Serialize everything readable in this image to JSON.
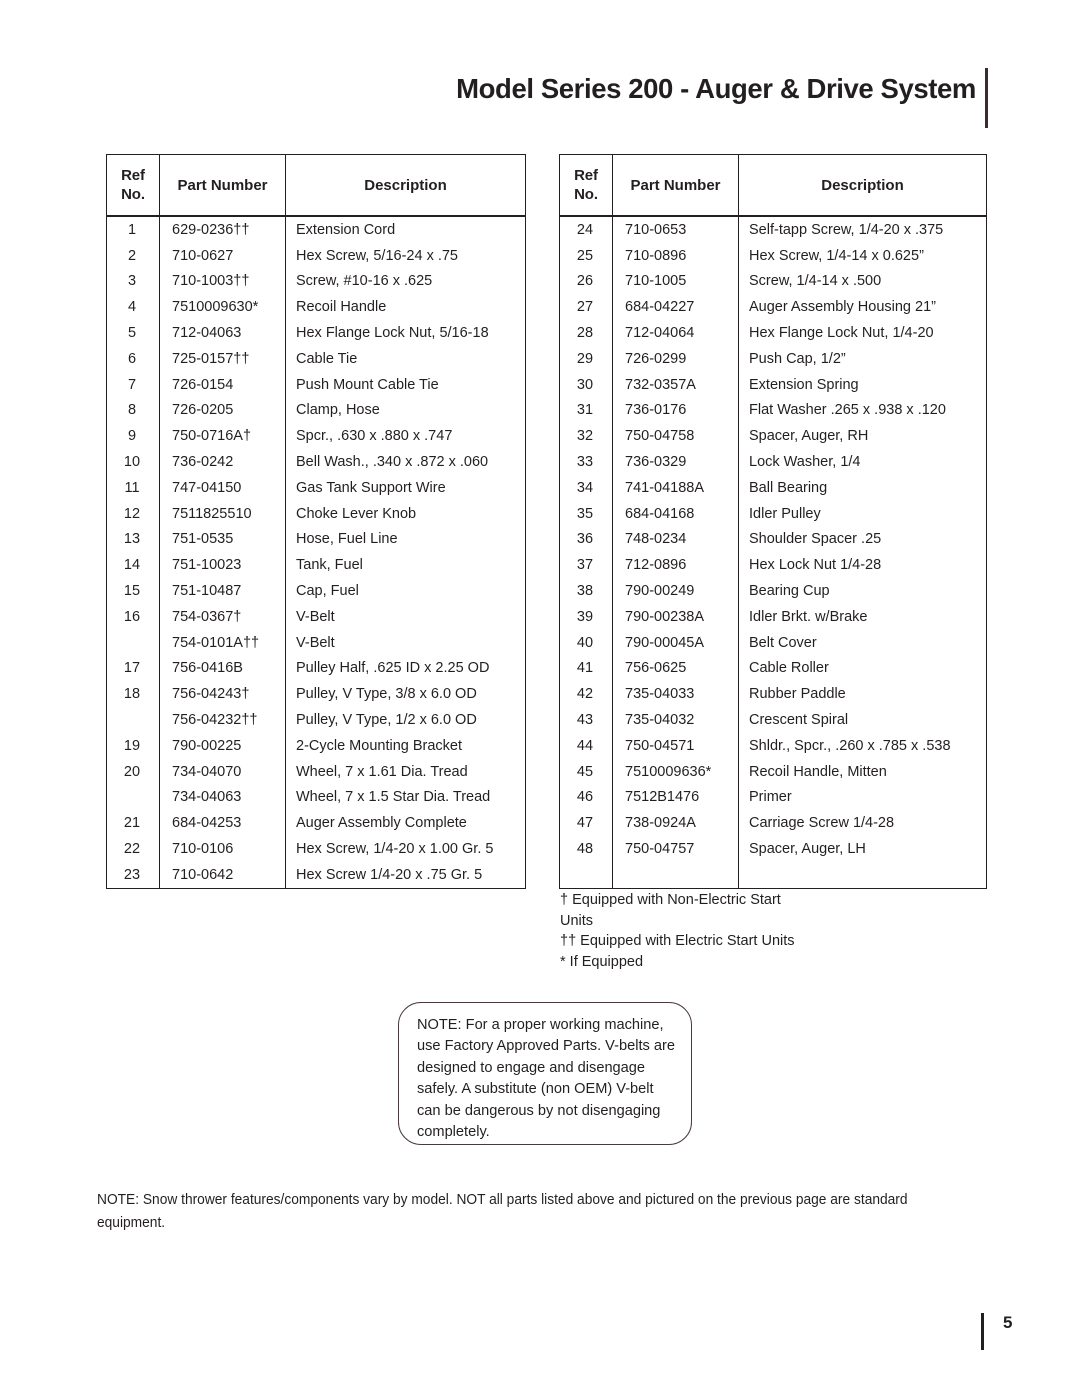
{
  "header": {
    "title": "Model Series 200  - Auger & Drive System"
  },
  "table_columns": {
    "ref_line1": "Ref",
    "ref_line2": "No.",
    "part_number": "Part Number",
    "description": "Description"
  },
  "parts_left": [
    {
      "ref": "1",
      "part": "629-0236††",
      "desc": "Extension Cord"
    },
    {
      "ref": "2",
      "part": "710-0627",
      "desc": "Hex Screw, 5/16-24 x .75"
    },
    {
      "ref": "3",
      "part": "710-1003††",
      "desc": "Screw, #10-16 x .625"
    },
    {
      "ref": "4",
      "part": "7510009630*",
      "desc": "Recoil Handle"
    },
    {
      "ref": "5",
      "part": "712-04063",
      "desc": "Hex Flange Lock Nut, 5/16-18"
    },
    {
      "ref": "6",
      "part": "725-0157††",
      "desc": "Cable Tie"
    },
    {
      "ref": "7",
      "part": "726-0154",
      "desc": "Push Mount Cable Tie"
    },
    {
      "ref": "8",
      "part": "726-0205",
      "desc": "Clamp, Hose"
    },
    {
      "ref": "9",
      "part": "750-0716A†",
      "desc": "Spcr., .630 x .880 x .747"
    },
    {
      "ref": "10",
      "part": "736-0242",
      "desc": "Bell Wash., .340  x .872 x .060"
    },
    {
      "ref": "11",
      "part": "747-04150",
      "desc": "Gas Tank Support Wire"
    },
    {
      "ref": "12",
      "part": "7511825510",
      "desc": "Choke Lever Knob"
    },
    {
      "ref": "13",
      "part": "751-0535",
      "desc": "Hose, Fuel Line"
    },
    {
      "ref": "14",
      "part": "751-10023",
      "desc": "Tank, Fuel"
    },
    {
      "ref": "15",
      "part": "751-10487",
      "desc": "Cap, Fuel"
    },
    {
      "ref": "16",
      "part": "754-0367†",
      "desc": "V-Belt"
    },
    {
      "ref": "",
      "part": "754-0101A††",
      "desc": "V-Belt"
    },
    {
      "ref": "17",
      "part": "756-0416B",
      "desc": "Pulley Half, .625 ID x 2.25 OD"
    },
    {
      "ref": "18",
      "part": "756-04243†",
      "desc": "Pulley, V Type, 3/8 x 6.0 OD"
    },
    {
      "ref": "",
      "part": "756-04232††",
      "desc": "Pulley, V Type, 1/2 x 6.0 OD"
    },
    {
      "ref": "19",
      "part": "790-00225",
      "desc": "2-Cycle Mounting Bracket"
    },
    {
      "ref": "20",
      "part": "734-04070",
      "desc": "Wheel, 7 x 1.61 Dia. Tread"
    },
    {
      "ref": "",
      "part": "734-04063",
      "desc": "Wheel, 7 x 1.5 Star Dia. Tread"
    },
    {
      "ref": "21",
      "part": "684-04253",
      "desc": "Auger Assembly Complete"
    },
    {
      "ref": "22",
      "part": "710-0106",
      "desc": "Hex Screw, 1/4-20 x 1.00 Gr. 5"
    },
    {
      "ref": "23",
      "part": "710-0642",
      "desc": "Hex Screw 1/4-20 x .75 Gr. 5"
    }
  ],
  "parts_right": [
    {
      "ref": "24",
      "part": "710-0653",
      "desc": "Self-tapp Screw, 1/4-20 x .375"
    },
    {
      "ref": "25",
      "part": "710-0896",
      "desc": "Hex Screw, 1/4-14 x 0.625”"
    },
    {
      "ref": "26",
      "part": "710-1005",
      "desc": "Screw, 1/4-14 x .500"
    },
    {
      "ref": "27",
      "part": "684-04227",
      "desc": "Auger Assembly Housing 21”"
    },
    {
      "ref": "28",
      "part": "712-04064",
      "desc": "Hex Flange Lock Nut, 1/4-20"
    },
    {
      "ref": "29",
      "part": "726-0299",
      "desc": "Push Cap, 1/2”"
    },
    {
      "ref": "30",
      "part": "732-0357A",
      "desc": "Extension Spring"
    },
    {
      "ref": "31",
      "part": "736-0176",
      "desc": "Flat Washer .265 x .938 x .120"
    },
    {
      "ref": "32",
      "part": "750-04758",
      "desc": "Spacer, Auger, RH"
    },
    {
      "ref": "33",
      "part": "736-0329",
      "desc": "Lock Washer, 1/4"
    },
    {
      "ref": "34",
      "part": "741-04188A",
      "desc": "Ball Bearing"
    },
    {
      "ref": "35",
      "part": "684-04168",
      "desc": "Idler Pulley"
    },
    {
      "ref": "36",
      "part": "748-0234",
      "desc": "Shoulder Spacer .25"
    },
    {
      "ref": "37",
      "part": "712-0896",
      "desc": "Hex Lock Nut 1/4-28"
    },
    {
      "ref": "38",
      "part": "790-00249",
      "desc": "Bearing Cup"
    },
    {
      "ref": "39",
      "part": "790-00238A",
      "desc": "Idler Brkt. w/Brake"
    },
    {
      "ref": "40",
      "part": "790-00045A",
      "desc": "Belt Cover"
    },
    {
      "ref": "41",
      "part": "756-0625",
      "desc": "Cable Roller"
    },
    {
      "ref": "42",
      "part": "735-04033",
      "desc": "Rubber Paddle"
    },
    {
      "ref": "43",
      "part": "735-04032",
      "desc": "Crescent Spiral"
    },
    {
      "ref": "44",
      "part": "750-04571",
      "desc": "Shldr., Spcr., .260 x .785 x .538"
    },
    {
      "ref": "45",
      "part": "7510009636*",
      "desc": "Recoil Handle, Mitten"
    },
    {
      "ref": "46",
      "part": "7512B1476",
      "desc": "Primer"
    },
    {
      "ref": "47",
      "part": "738-0924A",
      "desc": "Carriage Screw 1/4-28"
    },
    {
      "ref": "48",
      "part": "750-04757",
      "desc": "Spacer, Auger, LH"
    },
    {
      "ref": "",
      "part": "",
      "desc": ""
    }
  ],
  "footnotes": {
    "line1": "† Equipped with Non-Electric Start",
    "line2": "Units",
    "line3": "†† Equipped with Electric Start Units",
    "line4": "* If Equipped"
  },
  "note_callout": {
    "text": "NOTE: For a proper working machine, use Factory Approved Parts.  V-belts are designed to engage and disengage safely. A substitute (non OEM) V-belt can be dangerous by not disengaging completely."
  },
  "bottom_note": {
    "text": "NOTE: Snow thrower features/components vary by model. NOT all parts listed above and pictured on the previous page are standard equipment."
  },
  "footer": {
    "page_number": "5"
  }
}
